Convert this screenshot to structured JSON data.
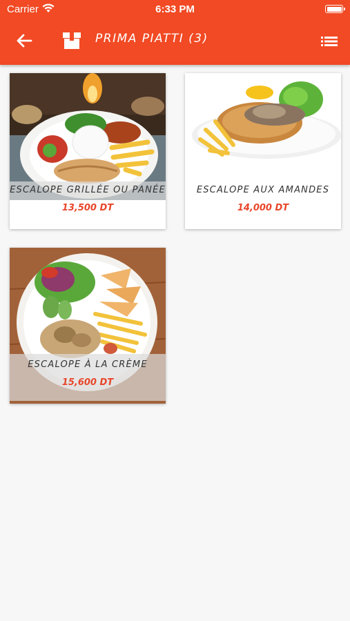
{
  "status_bar": {
    "carrier": "Carrier",
    "time": "6:33 PM"
  },
  "header": {
    "title": "PRIMA PIATTI (3)",
    "back_icon": "arrow-left-icon",
    "category_icon": "box-icon",
    "menu_icon": "list-icon"
  },
  "colors": {
    "accent": "#f14a24",
    "price": "#e8462a",
    "background": "#f7f7f7"
  },
  "dishes": [
    {
      "name": "ESCALOPE GRILLÉE OU PANÉE",
      "price": "13,500 DT"
    },
    {
      "name": "ESCALOPE AUX AMANDES",
      "price": "14,000 DT"
    },
    {
      "name": "ESCALOPE À LA CRÈME",
      "price": "15,600 DT"
    }
  ]
}
